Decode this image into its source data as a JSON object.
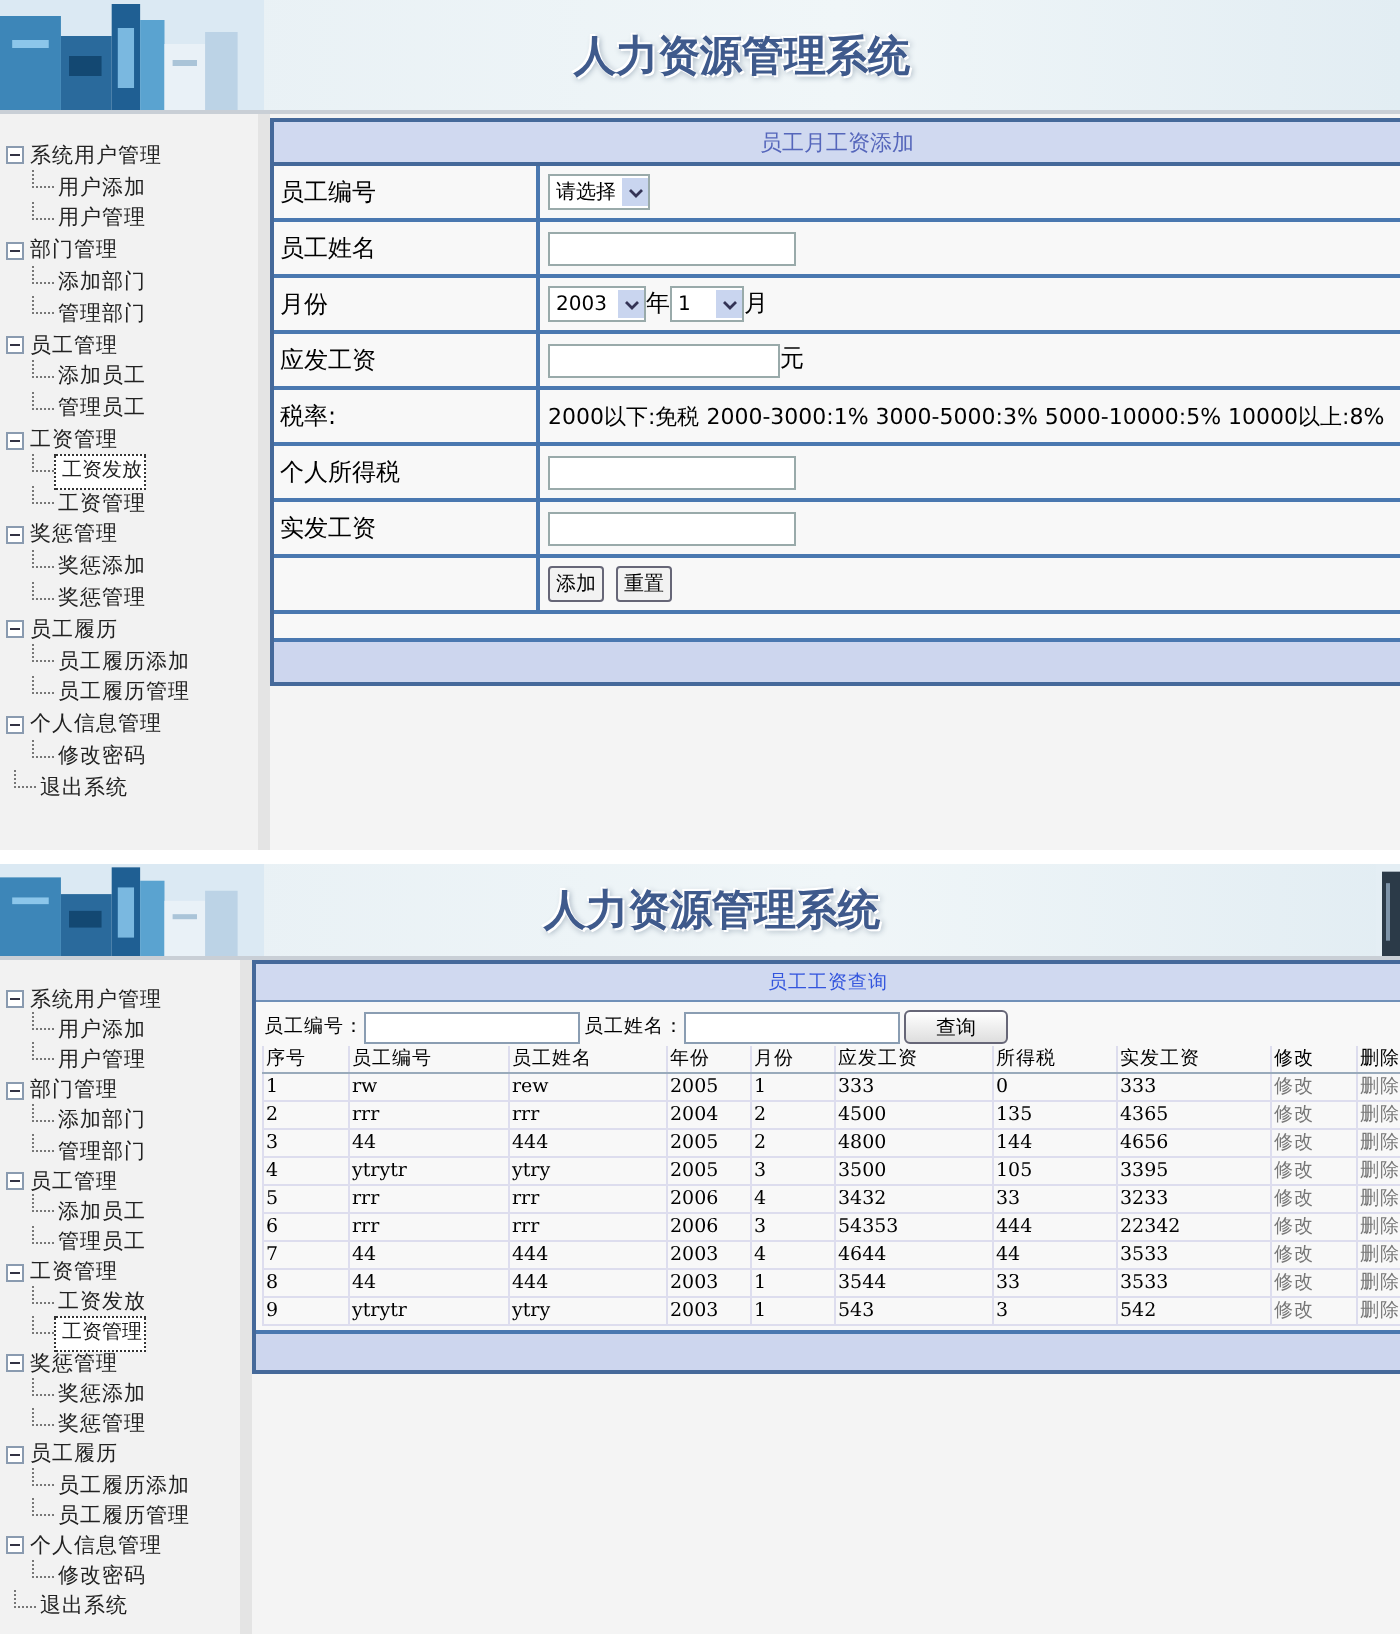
{
  "screens": [
    {
      "kind": "form",
      "header": {
        "title": "人力资源管理系统"
      },
      "sidebar": {
        "items": [
          {
            "label": "系统用户管理",
            "expanded": true,
            "children": [
              {
                "label": "用户添加",
                "selected": false
              },
              {
                "label": "用户管理",
                "selected": false
              }
            ]
          },
          {
            "label": "部门管理",
            "expanded": true,
            "children": [
              {
                "label": "添加部门",
                "selected": false
              },
              {
                "label": "管理部门",
                "selected": false
              }
            ]
          },
          {
            "label": "员工管理",
            "expanded": true,
            "children": [
              {
                "label": "添加员工",
                "selected": false
              },
              {
                "label": "管理员工",
                "selected": false
              }
            ]
          },
          {
            "label": "工资管理",
            "expanded": true,
            "children": [
              {
                "label": "工资发放",
                "selected": true
              },
              {
                "label": "工资管理",
                "selected": false
              }
            ]
          },
          {
            "label": "奖惩管理",
            "expanded": true,
            "children": [
              {
                "label": "奖惩添加",
                "selected": false
              },
              {
                "label": "奖惩管理",
                "selected": false
              }
            ]
          },
          {
            "label": "员工履历",
            "expanded": true,
            "children": [
              {
                "label": "员工履历添加",
                "selected": false
              },
              {
                "label": "员工履历管理",
                "selected": false
              }
            ]
          },
          {
            "label": "个人信息管理",
            "expanded": true,
            "children": [
              {
                "label": "修改密码",
                "selected": false
              }
            ]
          },
          {
            "label": "退出系统"
          }
        ]
      },
      "panel": {
        "title": "员工月工资添加",
        "rows": [
          {
            "kind": "select",
            "label": "员工编号",
            "value": "请选择"
          },
          {
            "kind": "input",
            "label": "员工姓名"
          },
          {
            "kind": "month",
            "label": "月份",
            "year": "2003",
            "year_unit": "年",
            "month": "1",
            "month_unit": "月"
          },
          {
            "kind": "input",
            "label": "应发工资",
            "unit": "元"
          },
          {
            "kind": "note",
            "label": "税率:",
            "text": "2000以下:免税  2000-3000:1% 3000-5000:3% 5000-10000:5% 10000以上:8%"
          },
          {
            "kind": "input",
            "label": "个人所得税"
          },
          {
            "kind": "input",
            "label": "实发工资"
          },
          {
            "kind": "buttons",
            "buttons": [
              "添加",
              "重置"
            ]
          }
        ]
      }
    },
    {
      "kind": "query",
      "header": {
        "title": "人力资源管理系统"
      },
      "sidebar": {
        "items": [
          {
            "label": "系统用户管理",
            "expanded": true,
            "children": [
              {
                "label": "用户添加",
                "selected": false
              },
              {
                "label": "用户管理",
                "selected": false
              }
            ]
          },
          {
            "label": "部门管理",
            "expanded": true,
            "children": [
              {
                "label": "添加部门",
                "selected": false
              },
              {
                "label": "管理部门",
                "selected": false
              }
            ]
          },
          {
            "label": "员工管理",
            "expanded": true,
            "children": [
              {
                "label": "添加员工",
                "selected": false
              },
              {
                "label": "管理员工",
                "selected": false
              }
            ]
          },
          {
            "label": "工资管理",
            "expanded": true,
            "children": [
              {
                "label": "工资发放",
                "selected": false
              },
              {
                "label": "工资管理",
                "selected": true
              }
            ]
          },
          {
            "label": "奖惩管理",
            "expanded": true,
            "children": [
              {
                "label": "奖惩添加",
                "selected": false
              },
              {
                "label": "奖惩管理",
                "selected": false
              }
            ]
          },
          {
            "label": "员工履历",
            "expanded": true,
            "children": [
              {
                "label": "员工履历添加",
                "selected": false
              },
              {
                "label": "员工履历管理",
                "selected": false
              }
            ]
          },
          {
            "label": "个人信息管理",
            "expanded": true,
            "children": [
              {
                "label": "修改密码",
                "selected": false
              }
            ]
          },
          {
            "label": "退出系统"
          }
        ]
      },
      "panel": {
        "title": "员工工资查询",
        "filters": [
          {
            "label": "员工编号："
          },
          {
            "label": "员工姓名："
          }
        ],
        "search_button": "查询",
        "columns": [
          {
            "label": "序号"
          },
          {
            "label": "员工编号"
          },
          {
            "label": "员工姓名"
          },
          {
            "label": "年份"
          },
          {
            "label": "月份"
          },
          {
            "label": "应发工资"
          },
          {
            "label": "所得税"
          },
          {
            "label": "实发工资"
          },
          {
            "label": "修改",
            "kind": "action"
          },
          {
            "label": "删除",
            "kind": "action"
          }
        ],
        "rows": [
          [
            "1",
            "rw",
            "rew",
            "2005",
            "1",
            "333",
            "0",
            "333",
            "修改",
            "删除"
          ],
          [
            "2",
            "rrr",
            "rrr",
            "2004",
            "2",
            "4500",
            "135",
            "4365",
            "修改",
            "删除"
          ],
          [
            "3",
            "44",
            "444",
            "2005",
            "2",
            "4800",
            "144",
            "4656",
            "修改",
            "删除"
          ],
          [
            "4",
            "ytrytr",
            "ytry",
            "2005",
            "3",
            "3500",
            "105",
            "3395",
            "修改",
            "删除"
          ],
          [
            "5",
            "rrr",
            "rrr",
            "2006",
            "4",
            "3432",
            "33",
            "3233",
            "修改",
            "删除"
          ],
          [
            "6",
            "rrr",
            "rrr",
            "2006",
            "3",
            "54353",
            "444",
            "22342",
            "修改",
            "删除"
          ],
          [
            "7",
            "44",
            "444",
            "2003",
            "4",
            "4644",
            "44",
            "3533",
            "修改",
            "删除"
          ],
          [
            "8",
            "44",
            "444",
            "2003",
            "1",
            "3544",
            "33",
            "3533",
            "修改",
            "删除"
          ],
          [
            "9",
            "ytrytr",
            "ytry",
            "2003",
            "1",
            "543",
            "3",
            "542",
            "修改",
            "删除"
          ]
        ]
      }
    }
  ]
}
